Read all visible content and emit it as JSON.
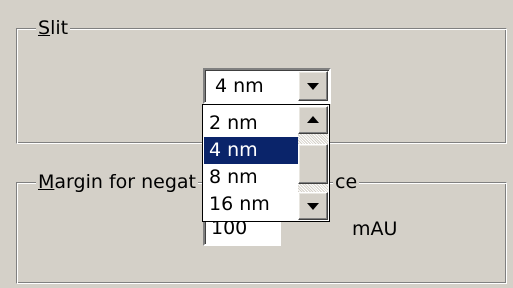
{
  "slit_group": {
    "label_accel": "S",
    "label_rest": "lit",
    "selected_value": "4 nm",
    "options": [
      "2 nm",
      "4 nm",
      "8 nm",
      "16 nm"
    ],
    "selected_index": 1
  },
  "margin_group": {
    "label_accel": "M",
    "label_rest": "argin for negat",
    "label_tail": "ce",
    "value": "100",
    "unit": "mAU"
  },
  "icons": {
    "combo_arrow": "chevron-down-icon",
    "scroll_up": "scroll-up-icon",
    "scroll_down": "scroll-down-icon"
  },
  "colors": {
    "face": "#d4d0c8",
    "highlight": "#0a246a"
  }
}
